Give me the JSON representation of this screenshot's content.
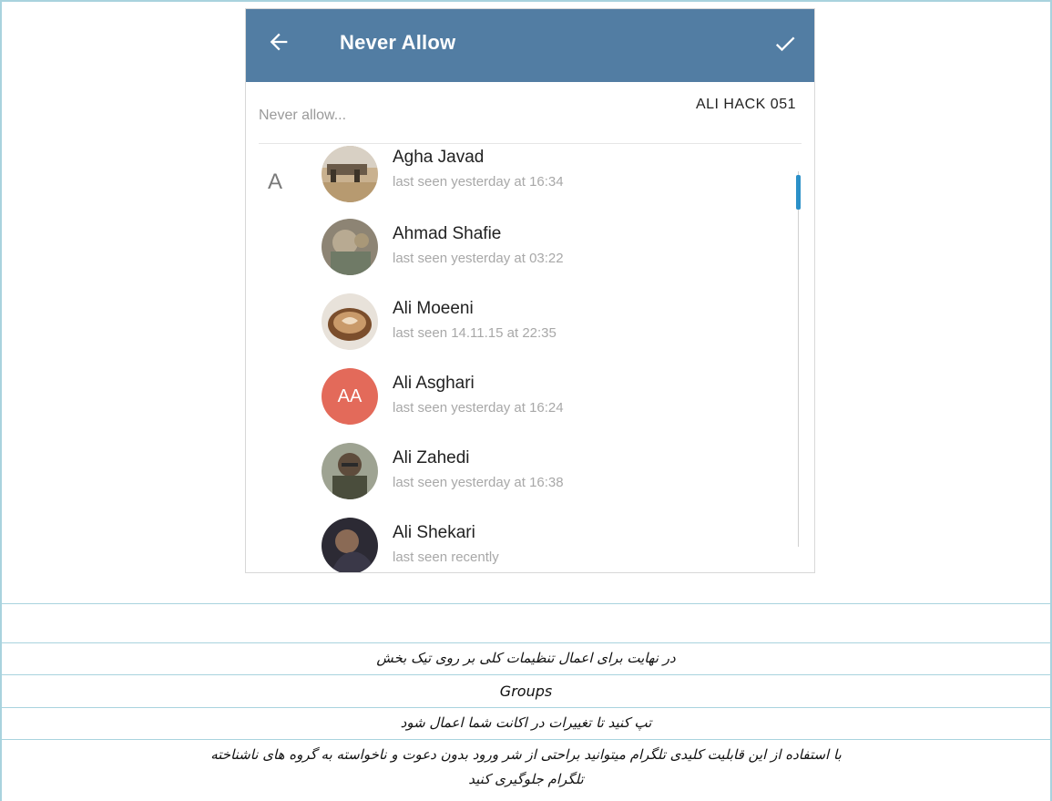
{
  "app": {
    "title": "Never Allow",
    "chip": "ALI HACK 051",
    "search_placeholder": "Never allow...",
    "section_letter": "A",
    "accent": "#527da3",
    "scroll_color": "#2b90c8"
  },
  "contacts": [
    {
      "name": "Agha Javad",
      "status": "last seen yesterday at 16:34"
    },
    {
      "name": "Ahmad Shafie",
      "status": "last seen yesterday at 03:22"
    },
    {
      "name": "Ali Moeeni",
      "status": "last seen 14.11.15 at 22:35"
    },
    {
      "name": "Ali Asghari",
      "status": "last seen yesterday at 16:24",
      "initials": "AA"
    },
    {
      "name": "Ali Zahedi",
      "status": "last seen yesterday at 16:38"
    },
    {
      "name": "Ali Shekari",
      "status": "last seen recently"
    }
  ],
  "caption": {
    "line1": "در نهایت برای اعمال تنظیمات کلی بر روی تیک بخش",
    "line2": "Groups",
    "line3": "تپ کنید تا تغییرات در اکانت شما اعمال شود",
    "line4": "با استفاده از این قابلیت کلیدی تلگرام میتوانید براحتی از شر ورود بدون دعوت و ناخواسته به گروه های ناشناخته",
    "line5": "تلگرام جلوگیری کنید"
  }
}
